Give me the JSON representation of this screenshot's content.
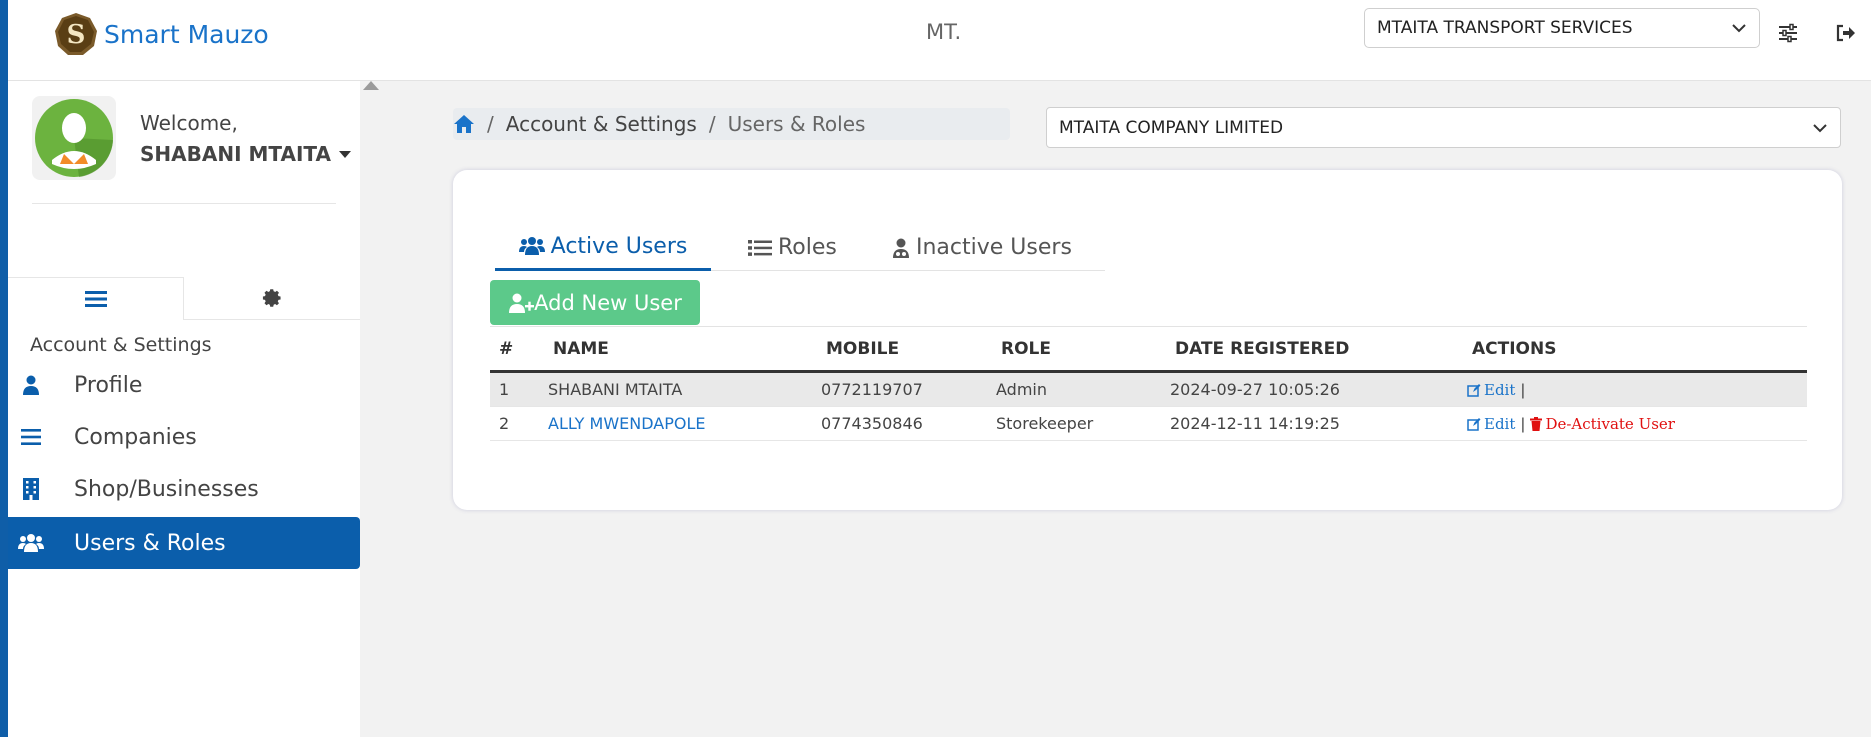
{
  "header": {
    "brand": "Smart Mauzo",
    "center_text": "MT.",
    "business_select": "MTAITA TRANSPORT SERVICES",
    "icons": [
      "sliders-icon",
      "logout-icon"
    ]
  },
  "sidebar": {
    "welcome": "Welcome,",
    "username": "SHABANI MTAITA",
    "section_title": "Account & Settings",
    "items": [
      {
        "label": "Profile",
        "icon": "user-icon"
      },
      {
        "label": "Companies",
        "icon": "list-icon"
      },
      {
        "label": "Shop/Businesses",
        "icon": "building-icon"
      },
      {
        "label": "Users & Roles",
        "icon": "users-icon",
        "active": true
      }
    ]
  },
  "breadcrumb": {
    "home_icon": "home-icon",
    "items": [
      "Account & Settings",
      "Users & Roles"
    ]
  },
  "company_select": "MTAITA COMPANY LIMITED",
  "tabs": [
    {
      "label": "Active Users",
      "icon": "users-icon",
      "active": true
    },
    {
      "label": "Roles",
      "icon": "list-icon"
    },
    {
      "label": "Inactive Users",
      "icon": "user-md-icon"
    }
  ],
  "add_button": "Add New User",
  "table": {
    "headers": [
      "#",
      "NAME",
      "MOBILE",
      "ROLE",
      "DATE REGISTERED",
      "ACTIONS"
    ],
    "rows": [
      {
        "num": "1",
        "name": "SHABANI MTAITA",
        "mobile": "0772119707",
        "role": "Admin",
        "date": "2024-09-27 10:05:26",
        "edit": "Edit",
        "deactivate": ""
      },
      {
        "num": "2",
        "name": "ALLY MWENDAPOLE",
        "mobile": "0774350846",
        "role": "Storekeeper",
        "date": "2024-12-11 14:19:25",
        "edit": "Edit",
        "deactivate": "De-Activate User"
      }
    ]
  },
  "colors": {
    "primary": "#0b5eab",
    "link": "#1a73c9",
    "success": "#5cc98a",
    "danger": "#e01010"
  }
}
